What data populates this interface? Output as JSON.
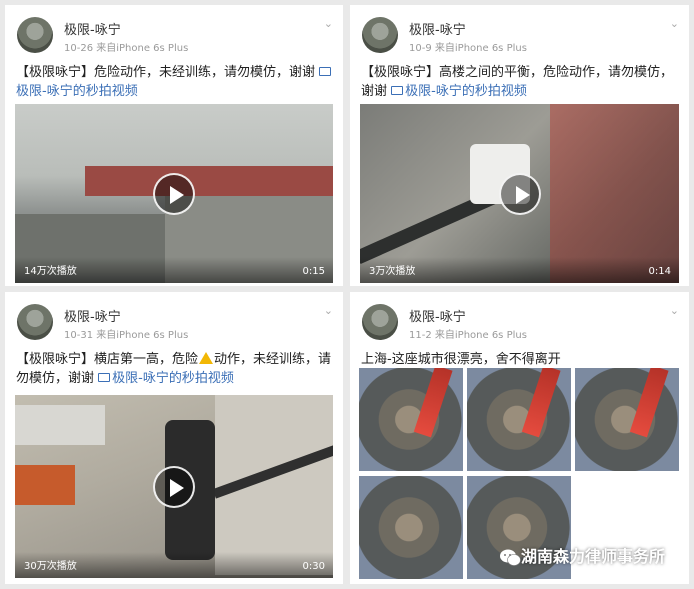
{
  "posts": [
    {
      "author": "极限-咏宁",
      "date": "10-26",
      "source": "来自iPhone 6s Plus",
      "text": "【极限咏宁】危险动作，未经训练，请勿模仿，谢谢",
      "link": "极限-咏宁的秒拍视频",
      "views": "14万次播放",
      "duration": "0:15"
    },
    {
      "author": "极限-咏宁",
      "date": "10-9",
      "source": "来自iPhone 6s Plus",
      "text": "【极限咏宁】高楼之间的平衡，危险动作，请勿模仿，谢谢",
      "link": "极限-咏宁的秒拍视频",
      "views": "3万次播放",
      "duration": "0:14"
    },
    {
      "author": "极限-咏宁",
      "date": "10-31",
      "source": "来自iPhone 6s Plus",
      "text_before": "【极限咏宁】横店第一高，危险",
      "text_after": "动作，未经训练，请勿模仿，谢谢",
      "link": "极限-咏宁的秒拍视频",
      "views": "30万次播放",
      "duration": "0:30"
    },
    {
      "author": "极限-咏宁",
      "date": "11-2",
      "source": "来自iPhone 6s Plus",
      "text": "上海-这座城市很漂亮，舍不得离开"
    }
  ],
  "watermark": "湖南森力律师事务所",
  "icons": {
    "chevron": "chevron-down-icon",
    "link": "video-link-icon",
    "play": "play-icon",
    "warning": "warning-icon",
    "wechat": "wechat-icon"
  }
}
